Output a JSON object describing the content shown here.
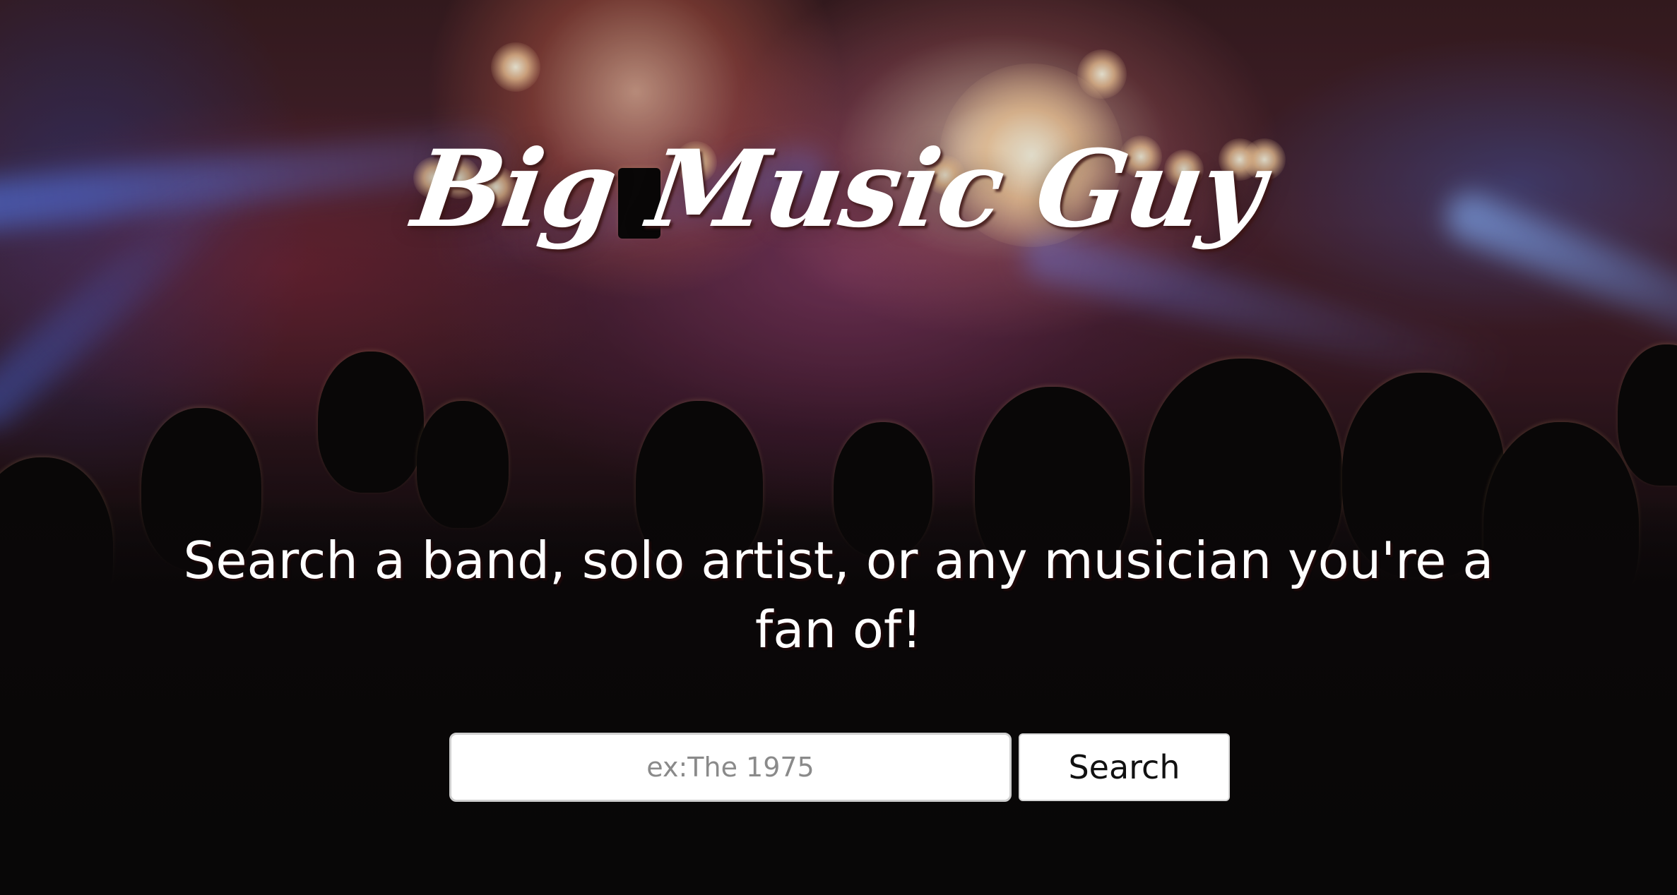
{
  "header": {
    "logo_text": "Big Music Guy"
  },
  "main": {
    "tagline": "Search a band, solo artist, or any musician you're a fan of!"
  },
  "search": {
    "placeholder": "ex:The 1975",
    "value": "",
    "button_label": "Search"
  },
  "background": {
    "description_icon": "concert-crowd-image"
  },
  "colors": {
    "text": "#ffffff",
    "input_background": "#ffffff",
    "button_background": "#ffffff",
    "button_text": "#111111",
    "placeholder": "#8a8a8a"
  }
}
